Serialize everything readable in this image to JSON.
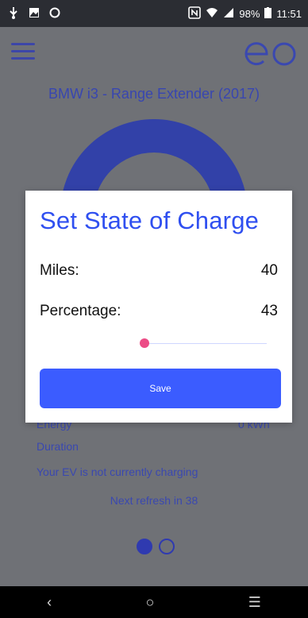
{
  "status_bar": {
    "battery_percent": "98%",
    "time": "11:51",
    "icons": [
      "usb-icon",
      "image-icon",
      "sync-icon",
      "nfc-icon",
      "wifi-icon",
      "signal-icon",
      "battery-icon"
    ]
  },
  "header": {
    "menu_icon": "hamburger-icon",
    "logo_text": "eo"
  },
  "vehicle": {
    "title": "BMW i3 - Range Extender (2017)"
  },
  "background_info": {
    "energy_label": "Energy",
    "energy_value": "0 kWh",
    "duration_label": "Duration",
    "charging_status": "Your EV is not currently charging",
    "refresh_text": "Next refresh in 38"
  },
  "pager": {
    "pages": 2,
    "active": 1
  },
  "modal": {
    "title": "Set State of Charge",
    "miles_label": "Miles:",
    "miles_value": "40",
    "percentage_label": "Percentage:",
    "percentage_value": "43",
    "slider_value_fraction": 0.0,
    "save_label": "Save"
  },
  "nav_bar": {
    "back_icon": "back-icon",
    "home_icon": "home-icon",
    "menu_icon": "recent-apps-icon"
  },
  "colors": {
    "accent": "#3b5cff",
    "primary": "#2f3ab0",
    "slider_thumb": "#ec4c86"
  }
}
